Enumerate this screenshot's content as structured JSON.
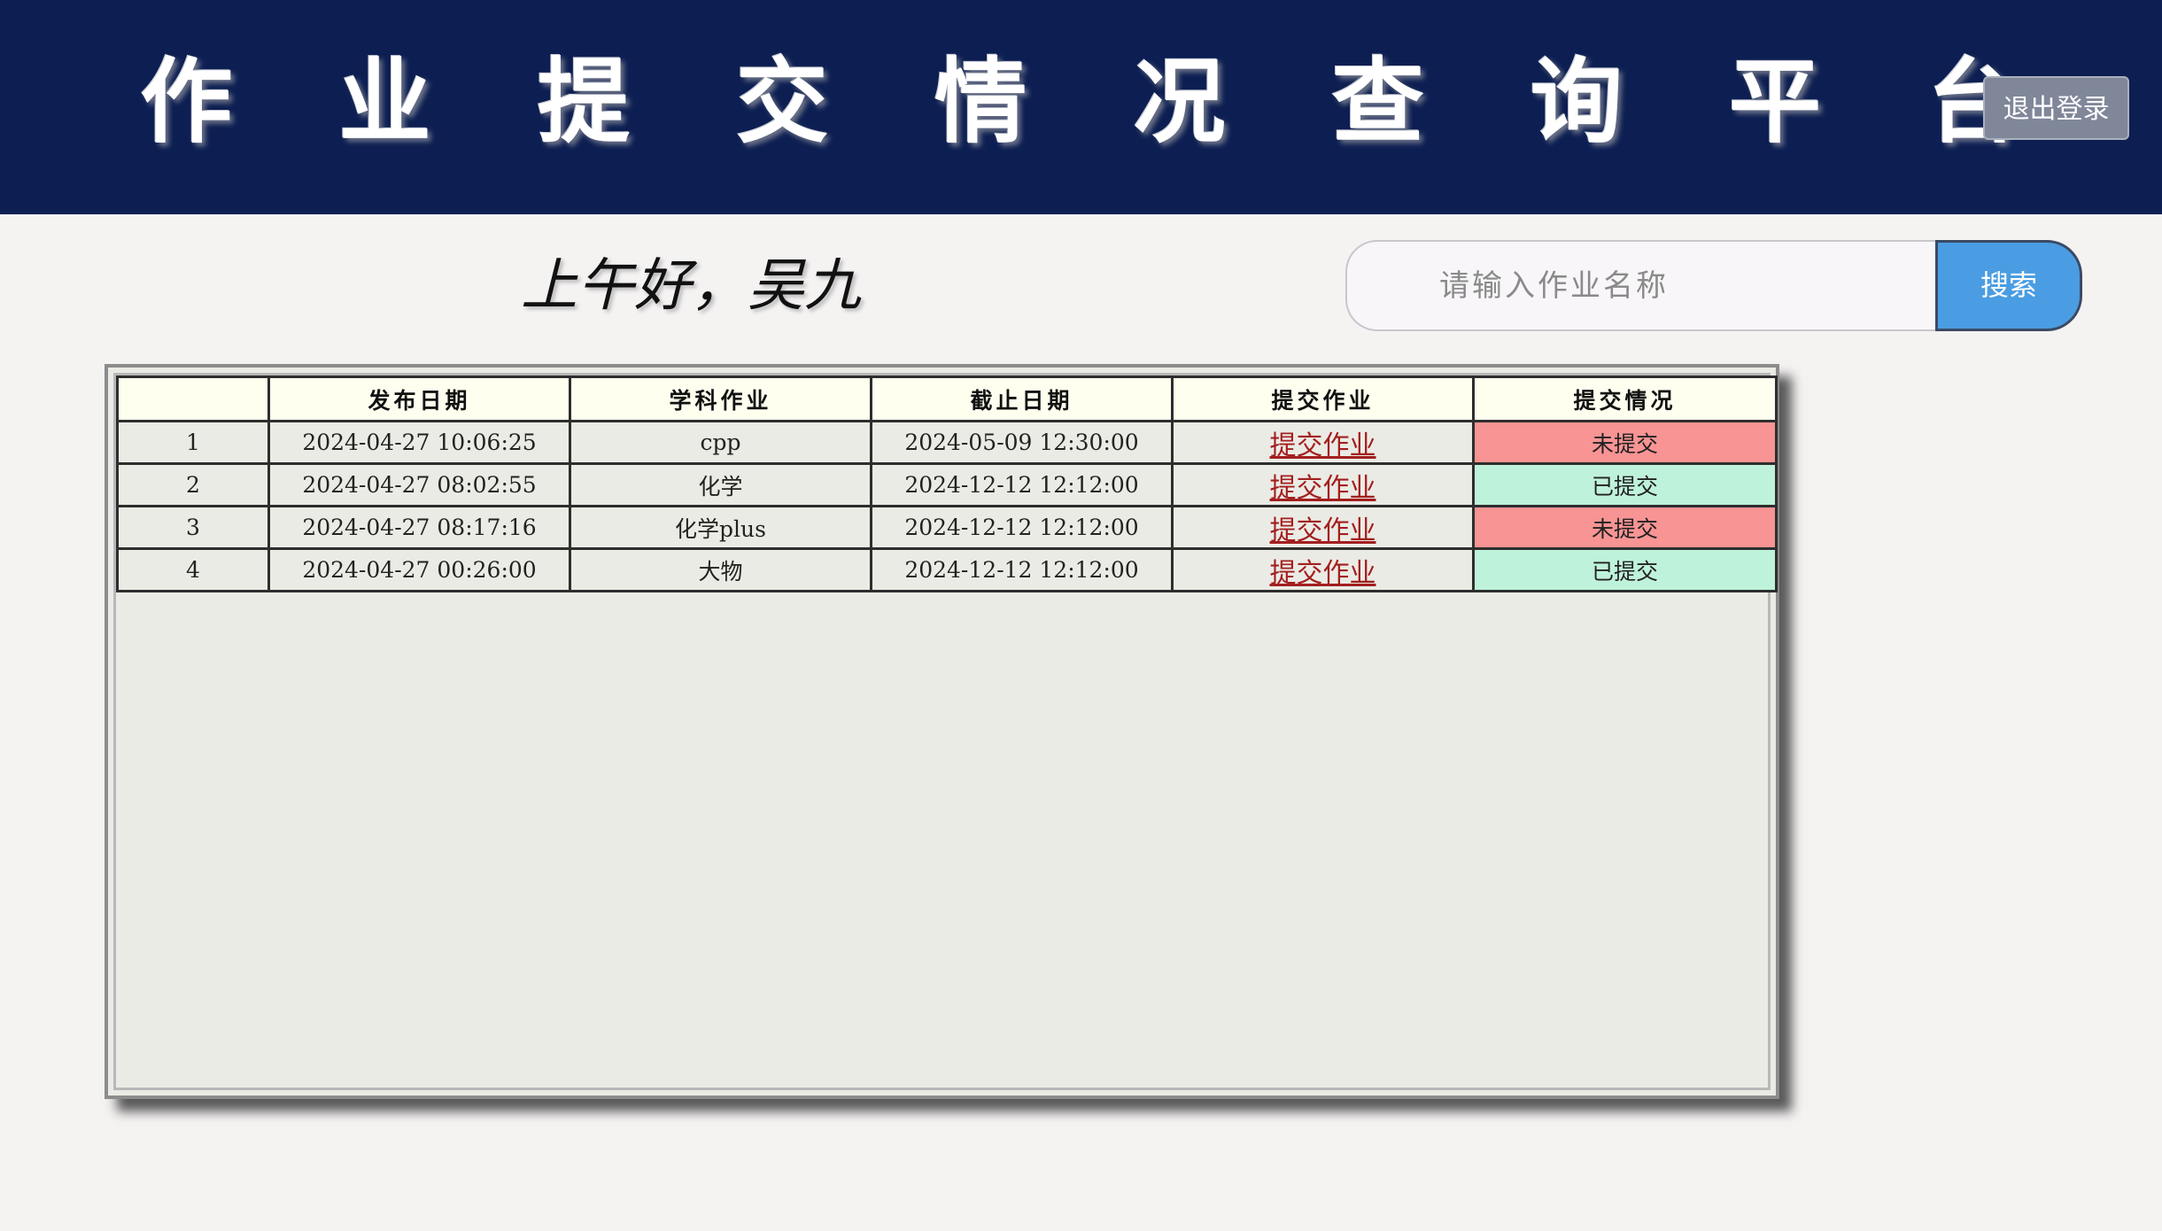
{
  "header": {
    "title": "作 业 提 交 情 况 查 询 平 台",
    "logout_label": "退出登录"
  },
  "greeting": "上午好，吴九",
  "search": {
    "placeholder": "请输入作业名称",
    "button_label": "搜索"
  },
  "table": {
    "columns": [
      "",
      "发布日期",
      "学科作业",
      "截止日期",
      "提交作业",
      "提交情况"
    ],
    "rows": [
      {
        "index": "1",
        "publish_date": "2024-04-27 10:06:25",
        "subject": "cpp",
        "deadline": "2024-05-09 12:30:00",
        "action": "提交作业",
        "status": "未提交",
        "status_type": "unsubmitted"
      },
      {
        "index": "2",
        "publish_date": "2024-04-27 08:02:55",
        "subject": "化学",
        "deadline": "2024-12-12 12:12:00",
        "action": "提交作业",
        "status": "已提交",
        "status_type": "submitted"
      },
      {
        "index": "3",
        "publish_date": "2024-04-27 08:17:16",
        "subject": "化学plus",
        "deadline": "2024-12-12 12:12:00",
        "action": "提交作业",
        "status": "未提交",
        "status_type": "unsubmitted"
      },
      {
        "index": "4",
        "publish_date": "2024-04-27 00:26:00",
        "subject": "大物",
        "deadline": "2024-12-12 12:12:00",
        "action": "提交作业",
        "status": "已提交",
        "status_type": "submitted"
      }
    ]
  },
  "colors": {
    "header_bg": "#0d1f52",
    "search_button": "#4a9de2",
    "unsubmitted": "#f89494",
    "submitted": "#bff2da",
    "link": "#a31f1f"
  }
}
